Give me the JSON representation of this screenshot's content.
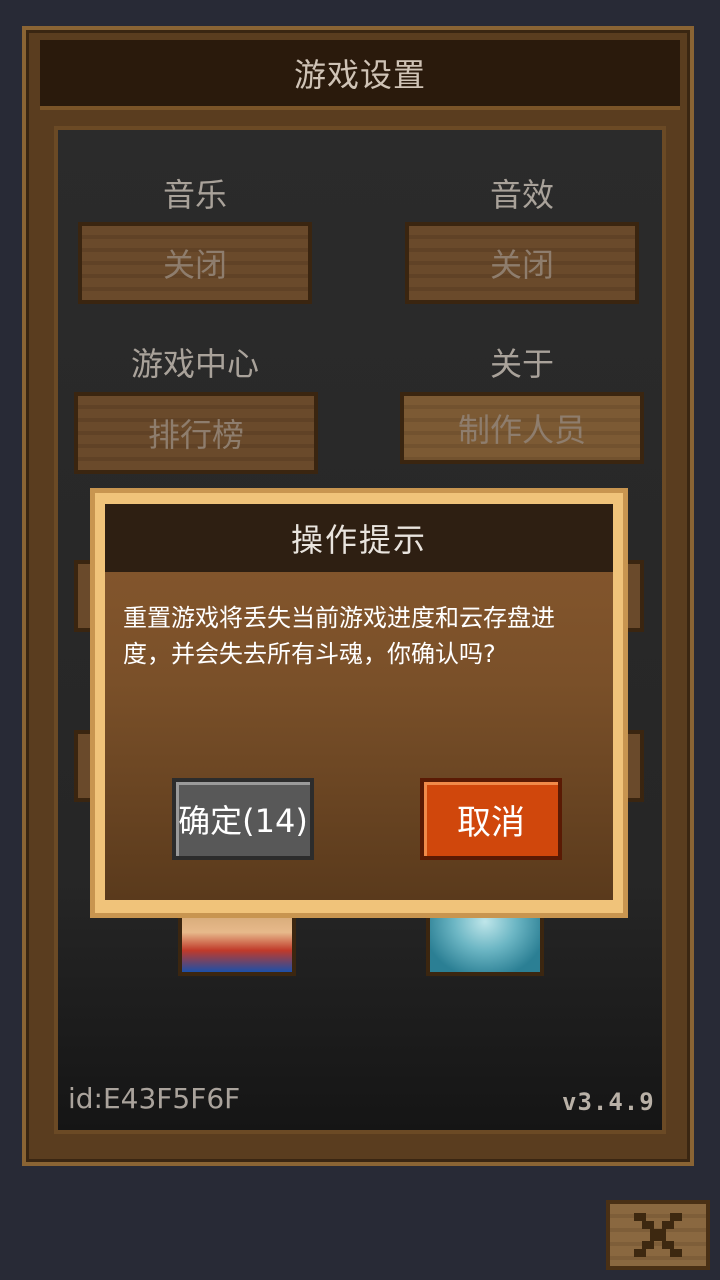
{
  "settings": {
    "title": "游戏设置",
    "music": {
      "label": "音乐",
      "button": "关闭"
    },
    "sound": {
      "label": "音效",
      "button": "关闭"
    },
    "game_center": {
      "label": "游戏中心",
      "button": "排行榜"
    },
    "about": {
      "label": "关于",
      "button": "制作人员"
    },
    "player_id": "id:E43F5F6F",
    "version": "v3.4.9"
  },
  "dialog": {
    "title": "操作提示",
    "message": "重置游戏将丢失当前游戏进度和云存盘进度，并会失去所有斗魂，你确认吗?",
    "confirm_label": "确定(14)",
    "cancel_label": "取消"
  },
  "colors": {
    "background": "#282a36",
    "wood": "#6a4a2b",
    "cancel_accent": "#d0470c",
    "confirm_gray": "#585858",
    "dialog_border": "#f0c37a"
  },
  "icons": {
    "close": "close-x-icon"
  }
}
